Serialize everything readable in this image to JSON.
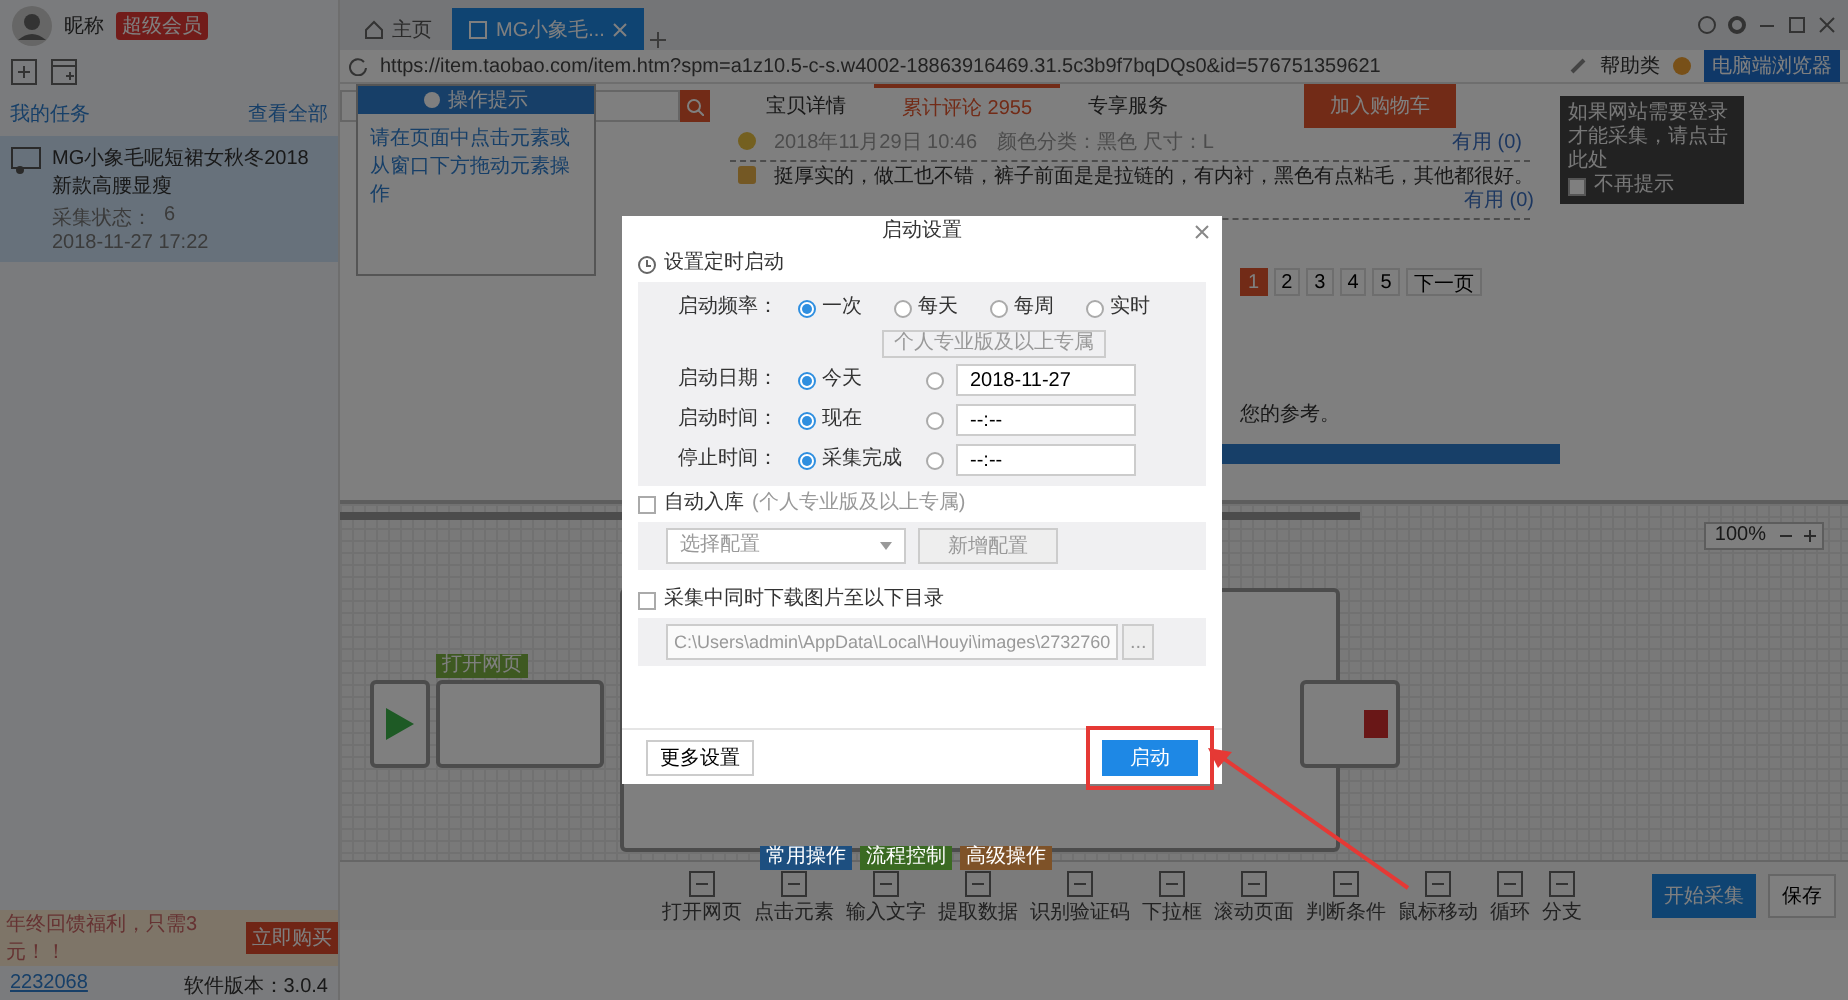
{
  "sidebar": {
    "nickname": "昵称",
    "badge": "超级会员",
    "section_title": "我的任务",
    "view_all": "查看全部",
    "tasks": [
      {
        "title": "MG小象毛呢短裙女秋冬2018新款高腰显瘦",
        "status": "采集状态：",
        "count": "6",
        "time": "2018-11-27 17:22",
        "selected": true
      }
    ],
    "promo": {
      "text": "年终回馈福利，只需3元！！",
      "button": "立即购买"
    },
    "account": "2232068",
    "version": "软件版本：3.0.4"
  },
  "browser": {
    "tabs": [
      {
        "kind": "home",
        "label": "主页",
        "selected": false
      },
      {
        "kind": "page",
        "label": "MG小象毛...",
        "selected": true
      }
    ],
    "url": "https://item.taobao.com/item.htm?spm=a1z10.5-c-s.w4002-18863916469.31.5c3b9f7bqDQs0&id=576751359621",
    "help": "帮助类",
    "mode_button": "电脑端浏览器",
    "tooltip": {
      "text": "如果网站需要登录才能采集，请点击此处",
      "dont_show": "不再提示",
      "dont_show_checked": false
    }
  },
  "page": {
    "tabs": [
      {
        "label": "宝贝详情",
        "selected": false
      },
      {
        "label": "累计评论",
        "count": "2955",
        "selected": true
      },
      {
        "label": "专享服务",
        "selected": false
      }
    ],
    "cart_button": "加入购物车",
    "reviews": [
      {
        "date": "2018年11月29日 10:46",
        "meta": "颜色分类：黑色  尺寸：L",
        "useful": "有用 (0)"
      },
      {
        "text": "挺厚实的，做工也不错，裤子前面是是拉链的，有内衬，黑色有点粘毛，其他都很好。",
        "useful": "有用 (0)"
      }
    ],
    "pages": [
      {
        "label": "1",
        "selected": true
      },
      {
        "label": "2",
        "selected": false
      },
      {
        "label": "3",
        "selected": false
      },
      {
        "label": "4",
        "selected": false
      },
      {
        "label": "5",
        "selected": false
      },
      {
        "label": "下一页",
        "selected": false
      }
    ],
    "snippet": "您的参考。"
  },
  "hint_panel": {
    "title": "操作提示",
    "text": "请在页面中点击元素或从窗口下方拖动元素操作"
  },
  "designer": {
    "zoom": "100%",
    "nodes": [
      {
        "label": "打开网页"
      }
    ]
  },
  "toolbar": {
    "tags": [
      {
        "label": "常用操作",
        "color": "#1d4f80"
      },
      {
        "label": "流程控制",
        "color": "#3a6a22"
      },
      {
        "label": "高级操作",
        "color": "#7e5228"
      }
    ],
    "tools": [
      "打开网页",
      "点击元素",
      "输入文字",
      "提取数据",
      "识别验证码",
      "下拉框",
      "滚动页面",
      "判断条件",
      "鼠标移动",
      "循环",
      "分支"
    ],
    "start": "开始采集",
    "save": "保存"
  },
  "dialog": {
    "title": "启动设置",
    "schedule_label": "设置定时启动",
    "rows": [
      {
        "label": "启动频率：",
        "options": [
          {
            "label": "一次",
            "selected": true
          },
          {
            "label": "每天",
            "selected": false
          },
          {
            "label": "每周",
            "selected": false
          },
          {
            "label": "实时",
            "selected": false
          }
        ],
        "note": "个人专业版及以上专属"
      },
      {
        "label": "启动日期：",
        "options": [
          {
            "label": "今天",
            "selected": true
          },
          {
            "selected": false
          }
        ],
        "value": "2018-11-27"
      },
      {
        "label": "启动时间：",
        "options": [
          {
            "label": "现在",
            "selected": true
          },
          {
            "selected": false
          }
        ],
        "value": "--:--"
      },
      {
        "label": "停止时间：",
        "options": [
          {
            "label": "采集完成",
            "selected": true
          },
          {
            "selected": false
          }
        ],
        "value": "--:--"
      }
    ],
    "auto_store": {
      "label": "自动入库",
      "note": "(个人专业版及以上专属)",
      "checked": false,
      "select": "选择配置",
      "button": "新增配置"
    },
    "download": {
      "label": "采集中同时下载图片至以下目录",
      "checked": false,
      "path": "C:\\Users\\admin\\AppData\\Local\\Houyi\\images\\2732760",
      "browse": "..."
    },
    "more": "更多设置",
    "start": "启动"
  }
}
